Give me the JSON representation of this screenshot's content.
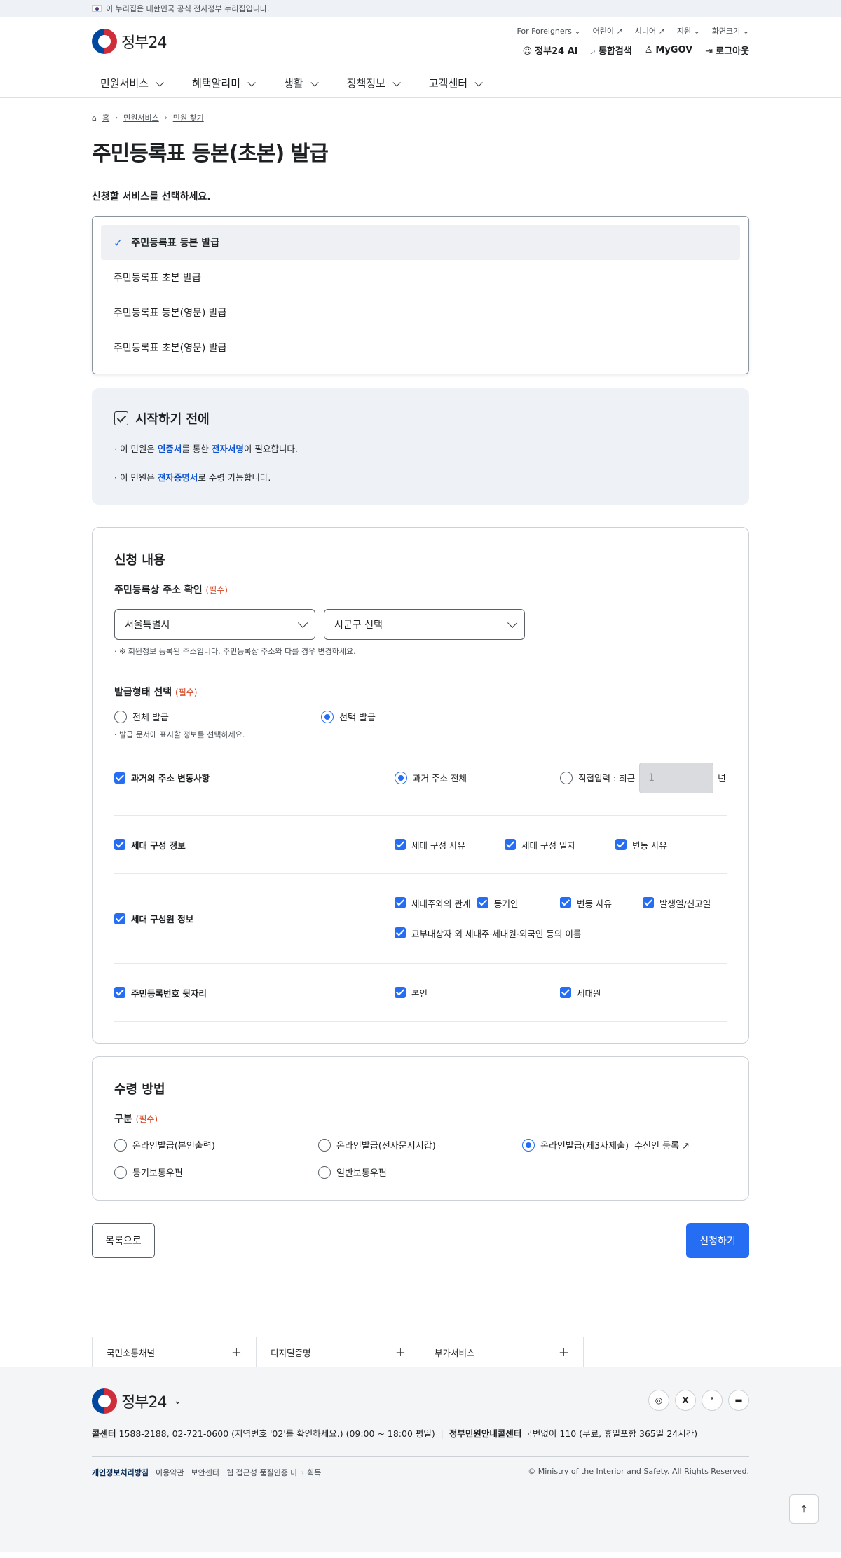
{
  "gov_banner": "이 누리집은 대한민국 공식 전자정부 누리집입니다.",
  "logo_text": "정부24",
  "util_links": [
    "For Foreigners",
    "어린이",
    "시니어",
    "지원",
    "화면크기"
  ],
  "main_links": [
    "정부24 AI",
    "통합검색",
    "MyGOV",
    "로그아웃"
  ],
  "gnb": [
    "민원서비스",
    "혜택알리미",
    "생활",
    "정책정보",
    "고객센터"
  ],
  "breadcrumb": [
    "홈",
    "민원서비스",
    "민원 찾기"
  ],
  "page_title": "주민등록표 등본(초본) 발급",
  "select_lead": "신청할 서비스를 선택하세요.",
  "services": [
    {
      "label": "주민등록표 등본 발급",
      "selected": true
    },
    {
      "label": "주민등록표 초본 발급",
      "selected": false
    },
    {
      "label": "주민등록표 등본(영문) 발급",
      "selected": false
    },
    {
      "label": "주민등록표 초본(영문) 발급",
      "selected": false
    }
  ],
  "before": {
    "title": "시작하기 전에",
    "item1": {
      "a": "이 민원은 ",
      "b": "인증서",
      "c": "를 통한 ",
      "d": "전자서명",
      "e": "이 필요합니다."
    },
    "item2": {
      "a": "이 민원은 ",
      "b": "전자증명서",
      "c": "로 수령 가능합니다."
    }
  },
  "apply": {
    "title": "신청 내용",
    "addr_label": "주민등록상 주소 확인",
    "required": "(필수)",
    "city": "서울특별시",
    "district": "시군구 선택",
    "addr_note": "· ※ 회원정보 등록된 주소입니다. 주민등록상 주소와 다를 경우 변경하세요.",
    "type_label": "발급형태 선택",
    "type_all": "전체 발급",
    "type_select": "선택 발급",
    "type_note": "· 발급 문서에 표시할 정보를 선택하세요.",
    "past_addr": "과거의 주소 변동사항",
    "past_all": "과거 주소 전체",
    "past_direct": "직접입력 :  최근",
    "past_value": "1",
    "past_unit": "년",
    "household": "세대 구성 정보",
    "household_opts": [
      "세대 구성 사유",
      "세대 구성 일자",
      "변동 사유"
    ],
    "members": "세대 구성원 정보",
    "members_opts": [
      "세대주와의 관계",
      "동거인",
      "변동 사유",
      "발생일/신고일"
    ],
    "members_extra": "교부대상자 외 세대주·세대원·외국인 등의 이름",
    "idnum": "주민등록번호 뒷자리",
    "idnum_opts": [
      "본인",
      "세대원"
    ]
  },
  "receive": {
    "title": "수령 방법",
    "label": "구분",
    "required": "(필수)",
    "opts": [
      "온라인발급(본인출력)",
      "온라인발급(전자문서지갑)",
      "온라인발급(제3자제출)",
      "등기보통우편",
      "일반보통우편"
    ],
    "recipient_link": "수신인 등록"
  },
  "buttons": {
    "list": "목록으로",
    "apply": "신청하기"
  },
  "footer_links": [
    "국민소통채널",
    "디지털증명",
    "부가서비스"
  ],
  "footer": {
    "call_label": "콜센터",
    "call_text": " 1588-2188, 02-721-0600 (지역번호 '02'를 확인하세요.) (09:00 ~ 18:00 평일)",
    "center_label": "정부민원안내콜센터",
    "center_text": " 국번없이 110 (무료, 휴일포함 365일 24시간)",
    "links": [
      "개인정보처리방침",
      "이용약관",
      "보안센터",
      "웹 접근성 품질인증 마크 획득"
    ],
    "copyright": "© Ministry of the Interior and Safety. All Rights Reserved."
  },
  "social": [
    "instagram-icon",
    "x-icon",
    "blog-icon",
    "talk-icon"
  ]
}
